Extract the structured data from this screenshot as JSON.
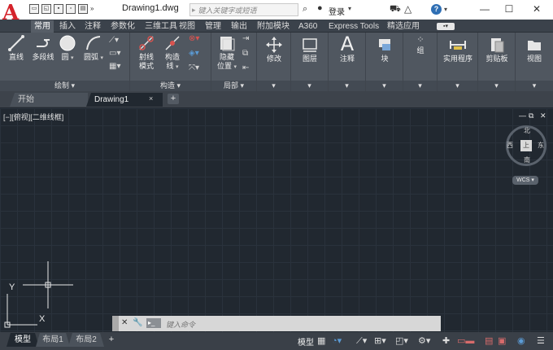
{
  "app": {
    "logo": "A",
    "quick_access_more": "»",
    "document_title": "Drawing1.dwg",
    "search_separator": "▸",
    "search_placeholder": "键入关键字或短语",
    "login": "登录",
    "help": "?"
  },
  "ribbon_tabs": [
    "常用",
    "插入",
    "注释",
    "参数化",
    "三维工具",
    "视图",
    "管理",
    "输出",
    "附加模块",
    "A360",
    "Express Tools",
    "精选应用"
  ],
  "ribbon": {
    "draw": {
      "title": "绘制",
      "line": "直线",
      "polyline": "多段线",
      "circle": "圆",
      "arc": "圆弧"
    },
    "construct": {
      "title": "构造",
      "ray": [
        "射线",
        "模式"
      ],
      "xline": [
        "构造",
        "线"
      ]
    },
    "local": {
      "title": "局部",
      "hide": [
        "隐藏",
        "位置"
      ]
    },
    "modify": "修改",
    "layers": "图层",
    "annotation": "注释",
    "block": "块",
    "groups": "组",
    "utilities": "实用程序",
    "clipboard": "剪贴板",
    "view": "视图"
  },
  "doc_tabs": {
    "start": "开始",
    "drawing": "Drawing1",
    "close": "×",
    "add": "+"
  },
  "canvas": {
    "view_label": "[−][俯视][二维线框]",
    "viewcube": {
      "north": "北",
      "south": "南",
      "east": "东",
      "west": "西",
      "face": "上"
    },
    "wcs": "WCS",
    "axis_y": "Y",
    "axis_x": "X"
  },
  "command_line": {
    "placeholder": "键入命令",
    "prompt": "▸_"
  },
  "layout_tabs": [
    "模型",
    "布局1",
    "布局2"
  ],
  "layout_add": "+",
  "status": {
    "model": "模型"
  },
  "colors": {
    "canvas_bg": "#212830",
    "ribbon_bg": "#505760",
    "accent_red": "#d5232b"
  }
}
